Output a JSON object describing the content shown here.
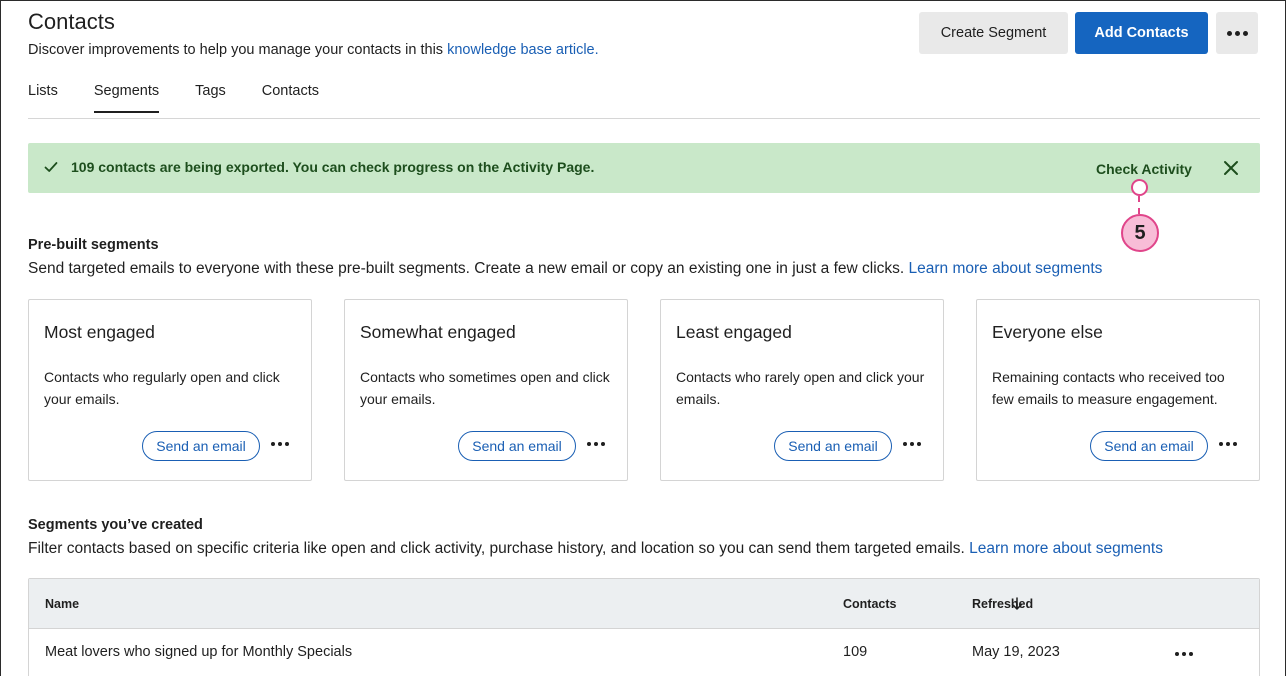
{
  "header": {
    "title": "Contacts",
    "subtitle_prefix": "Discover improvements to help you manage your contacts in this ",
    "subtitle_link": "knowledge base article.",
    "create_segment_label": "Create Segment",
    "add_contacts_label": "Add Contacts"
  },
  "tabs": [
    {
      "label": "Lists",
      "active": false
    },
    {
      "label": "Segments",
      "active": true
    },
    {
      "label": "Tags",
      "active": false
    },
    {
      "label": "Contacts",
      "active": false
    }
  ],
  "banner": {
    "message": "109 contacts are being exported. You can check progress on the Activity Page.",
    "action_label": "Check Activity",
    "color": "#c9e8c9"
  },
  "callout": {
    "number": "5"
  },
  "prebuilt": {
    "title": "Pre-built segments",
    "description": "Send targeted emails to everyone with these pre-built segments. Create a new email or copy an existing one in just a few clicks.",
    "link": "Learn more about segments",
    "cards": [
      {
        "title": "Most engaged",
        "description": "Contacts who regularly open and click your emails.",
        "button": "Send an email"
      },
      {
        "title": "Somewhat engaged",
        "description": "Contacts who sometimes open and click your emails.",
        "button": "Send an email"
      },
      {
        "title": "Least engaged",
        "description": "Contacts who rarely open and click your emails.",
        "button": "Send an email"
      },
      {
        "title": "Everyone else",
        "description": "Remaining contacts who received too few emails to measure engagement.",
        "button": "Send an email"
      }
    ]
  },
  "created": {
    "title": "Segments you’ve created",
    "description": "Filter contacts based on specific criteria like open and click activity, purchase history, and location so you can send them targeted emails.",
    "link": "Learn more about segments"
  },
  "table": {
    "columns": {
      "name": "Name",
      "contacts": "Contacts",
      "refreshed": "Refreshed"
    },
    "rows": [
      {
        "name": "Meat lovers who signed up for Monthly Specials",
        "contacts": "109",
        "refreshed": "May 19, 2023"
      }
    ]
  },
  "colors": {
    "primary": "#1565c0",
    "link": "#1a5fb4",
    "callout": "#e0458a"
  }
}
